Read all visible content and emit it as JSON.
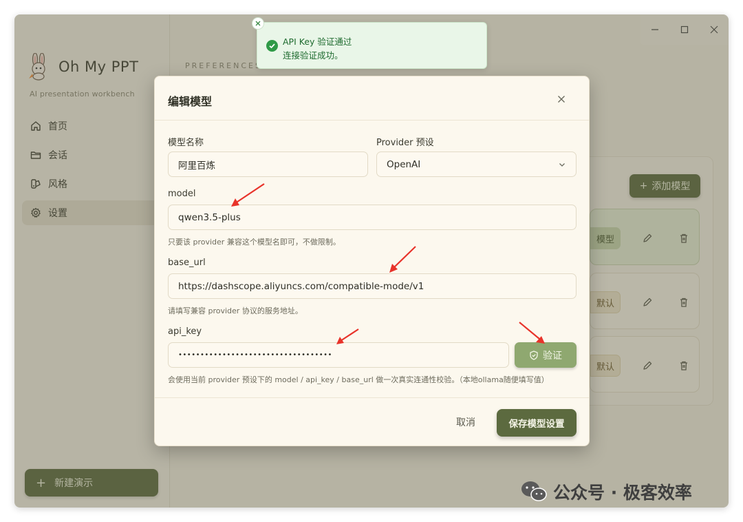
{
  "app": {
    "name": "Oh My PPT",
    "subtitle": "AI presentation workbench"
  },
  "sidebar": {
    "items": [
      {
        "label": "首页",
        "icon": "home-icon",
        "active": false
      },
      {
        "label": "会话",
        "icon": "folder-icon",
        "active": false
      },
      {
        "label": "风格",
        "icon": "palette-icon",
        "active": false
      },
      {
        "label": "设置",
        "icon": "gear-icon",
        "active": true
      }
    ],
    "new_button": "新建演示"
  },
  "main": {
    "kicker": "PREFERENCES",
    "add_model_label": "添加模型",
    "rows": [
      {
        "tag": "模型",
        "active": true
      },
      {
        "tag": "默认",
        "active": false
      },
      {
        "tag": "默认",
        "active": false
      }
    ]
  },
  "toast": {
    "title": "API Key 验证通过",
    "message": "连接验证成功。",
    "status_color": "#2f9a47"
  },
  "modal": {
    "title": "编辑模型",
    "name_label": "模型名称",
    "name_value": "阿里百炼",
    "provider_label": "Provider 预设",
    "provider_value": "OpenAI",
    "model_label": "model",
    "model_value": "qwen3.5-plus",
    "model_hint": "只要该 provider 兼容这个模型名即可，不做限制。",
    "base_url_label": "base_url",
    "base_url_value": "https://dashscope.aliyuncs.com/compatible-mode/v1",
    "base_url_hint": "请填写兼容 provider 协议的服务地址。",
    "api_key_label": "api_key",
    "api_key_value": "•••••••••••••••••••••••••••••••••••",
    "verify_label": "验证",
    "api_key_hint": "会使用当前 provider 预设下的 model / api_key / base_url 做一次真实连通性校验。（本地ollama随便填写值）",
    "cancel_label": "取消",
    "save_label": "保存模型设置"
  },
  "watermark": {
    "text": "公众号 · 极客效率"
  },
  "colors": {
    "accent": "#5c6a3f",
    "annotation_arrow": "#e8332a"
  }
}
